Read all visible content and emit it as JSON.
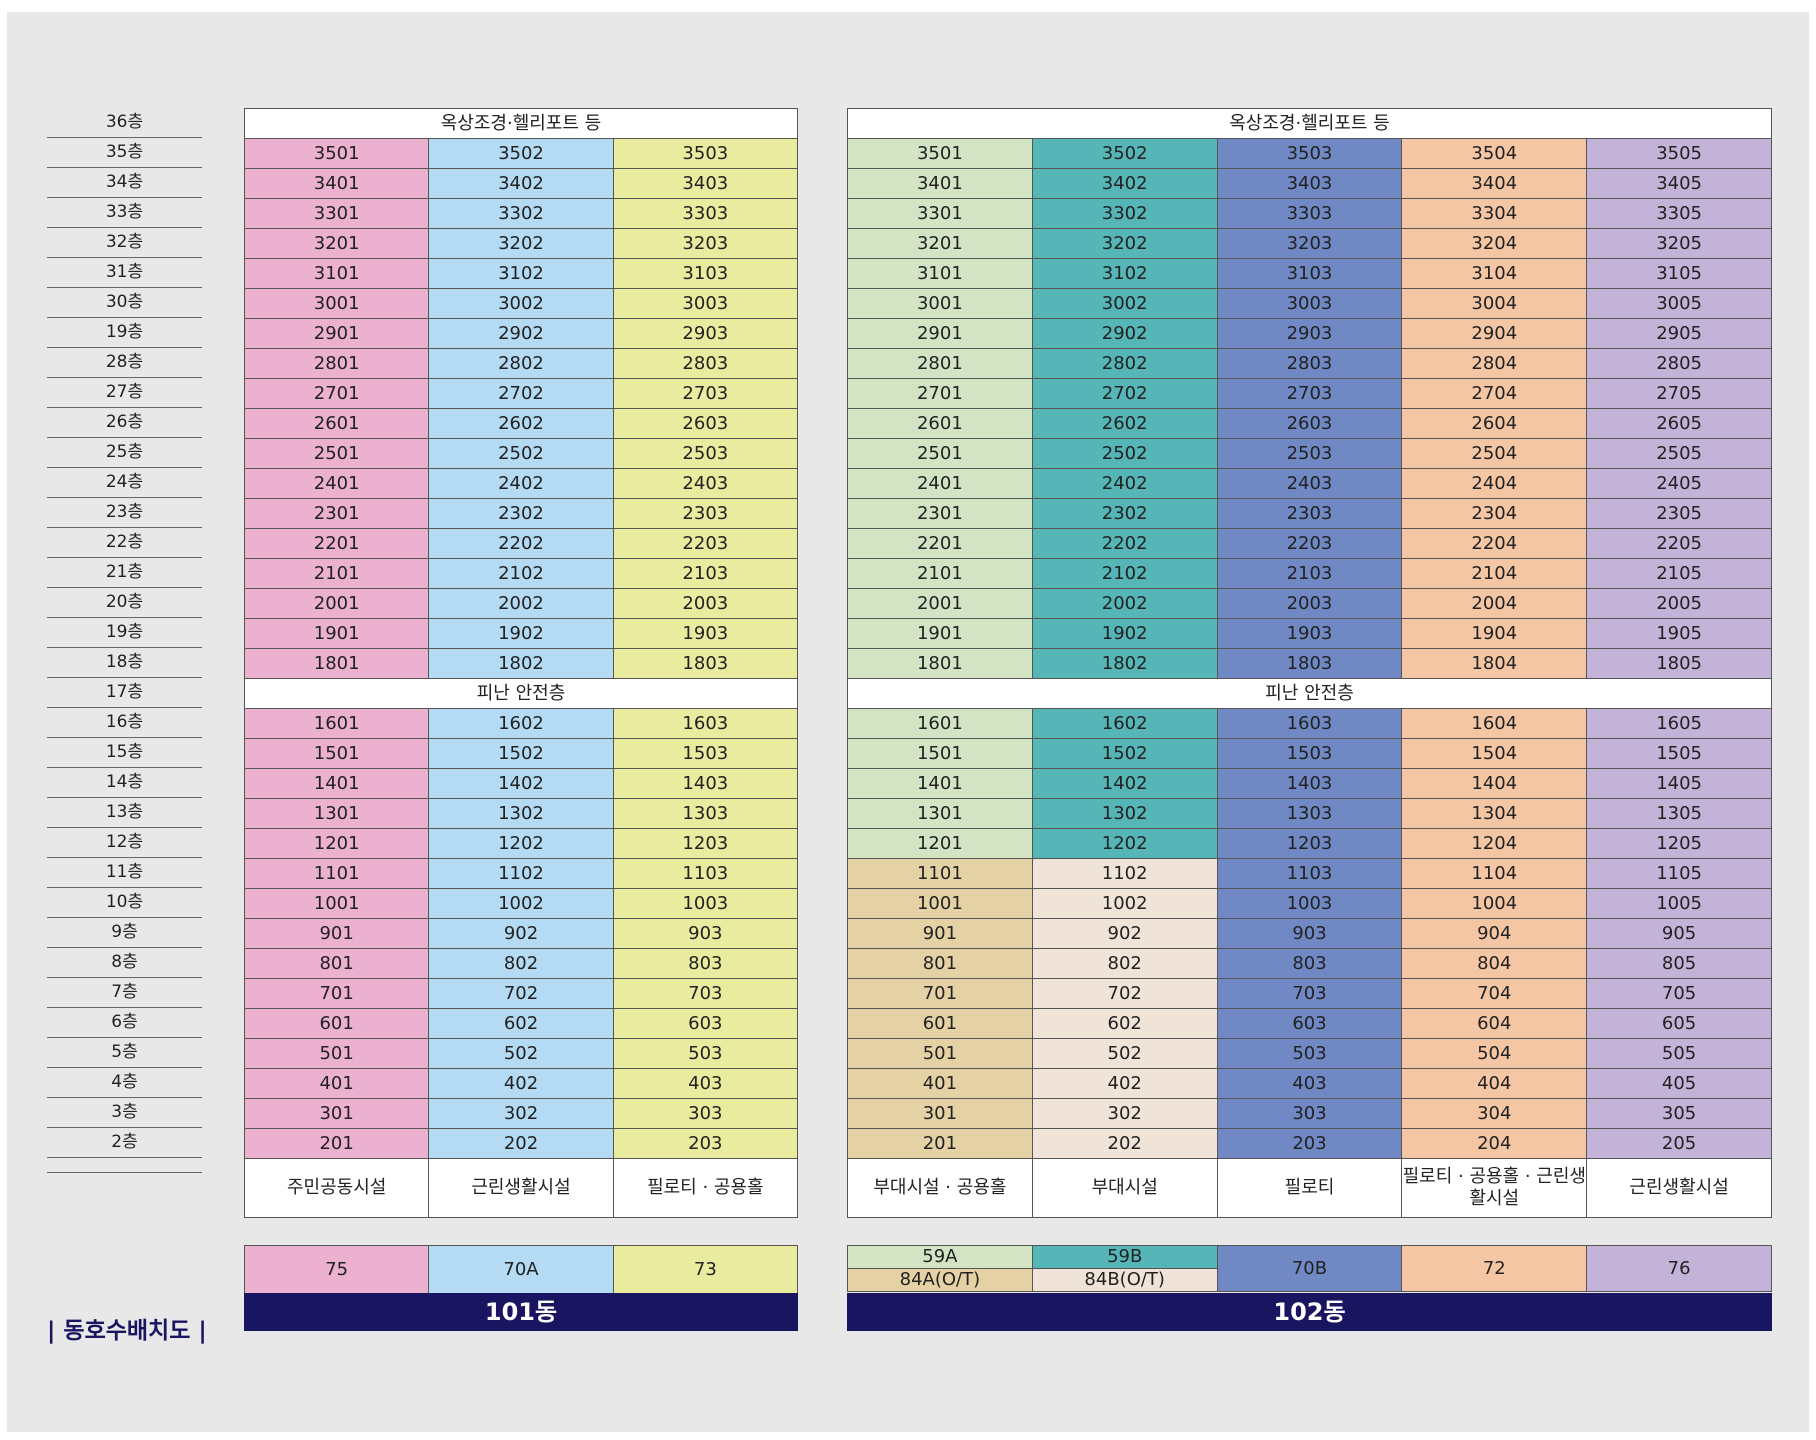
{
  "doc_title": "| 동호수배치도 |",
  "floors": [
    "36층",
    "35층",
    "34층",
    "33층",
    "32층",
    "31층",
    "30층",
    "19층",
    "28층",
    "27층",
    "26층",
    "25층",
    "24층",
    "23층",
    "22층",
    "21층",
    "20층",
    "19층",
    "18층",
    "17층",
    "16층",
    "15층",
    "14층",
    "13층",
    "12층",
    "11층",
    "10층",
    "9층",
    "8층",
    "7층",
    "6층",
    "5층",
    "4층",
    "3층",
    "2층"
  ],
  "colors": {
    "pink": "#ebb1cf",
    "lightblue": "#b4dbf3",
    "yellow": "#e9ec9f",
    "palegreen": "#d3e4c5",
    "teal": "#56b5b6",
    "blue": "#7089c4",
    "orange": "#f4c6a4",
    "purple": "#c4b3d9",
    "tan": "#e4d1a4",
    "beige": "#f0e4d8",
    "navy": "#1a1560"
  },
  "buildings": [
    {
      "name": "101동",
      "roof_label": "옥상조경·헬리포트 등",
      "refuge_label": "피난 안전층",
      "unit_colors": [
        [
          "pink",
          "lightblue",
          "yellow"
        ],
        [
          "pink",
          "lightblue",
          "yellow"
        ],
        [
          "pink",
          "lightblue",
          "yellow"
        ],
        [
          "pink",
          "lightblue",
          "yellow"
        ],
        [
          "pink",
          "lightblue",
          "yellow"
        ],
        [
          "pink",
          "lightblue",
          "yellow"
        ],
        [
          "pink",
          "lightblue",
          "yellow"
        ],
        [
          "pink",
          "lightblue",
          "yellow"
        ],
        [
          "pink",
          "lightblue",
          "yellow"
        ],
        [
          "pink",
          "lightblue",
          "yellow"
        ],
        [
          "pink",
          "lightblue",
          "yellow"
        ],
        [
          "pink",
          "lightblue",
          "yellow"
        ],
        [
          "pink",
          "lightblue",
          "yellow"
        ],
        [
          "pink",
          "lightblue",
          "yellow"
        ],
        [
          "pink",
          "lightblue",
          "yellow"
        ],
        [
          "pink",
          "lightblue",
          "yellow"
        ],
        [
          "pink",
          "lightblue",
          "yellow"
        ],
        [
          "pink",
          "lightblue",
          "yellow"
        ],
        [
          "pink",
          "lightblue",
          "yellow"
        ],
        [
          "pink",
          "lightblue",
          "yellow"
        ],
        [
          "pink",
          "lightblue",
          "yellow"
        ],
        [
          "pink",
          "lightblue",
          "yellow"
        ],
        [
          "pink",
          "lightblue",
          "yellow"
        ],
        [
          "pink",
          "lightblue",
          "yellow"
        ],
        [
          "pink",
          "lightblue",
          "yellow"
        ],
        [
          "pink",
          "lightblue",
          "yellow"
        ],
        [
          "pink",
          "lightblue",
          "yellow"
        ],
        [
          "pink",
          "lightblue",
          "yellow"
        ],
        [
          "pink",
          "lightblue",
          "yellow"
        ],
        [
          "pink",
          "lightblue",
          "yellow"
        ],
        [
          "pink",
          "lightblue",
          "yellow"
        ],
        [
          "pink",
          "lightblue",
          "yellow"
        ],
        [
          "pink",
          "lightblue",
          "yellow"
        ]
      ],
      "upper_units": [
        [
          "3501",
          "3502",
          "3503"
        ],
        [
          "3401",
          "3402",
          "3403"
        ],
        [
          "3301",
          "3302",
          "3303"
        ],
        [
          "3201",
          "3202",
          "3203"
        ],
        [
          "3101",
          "3102",
          "3103"
        ],
        [
          "3001",
          "3002",
          "3003"
        ],
        [
          "2901",
          "2902",
          "2903"
        ],
        [
          "2801",
          "2802",
          "2803"
        ],
        [
          "2701",
          "2702",
          "2703"
        ],
        [
          "2601",
          "2602",
          "2603"
        ],
        [
          "2501",
          "2502",
          "2503"
        ],
        [
          "2401",
          "2402",
          "2403"
        ],
        [
          "2301",
          "2302",
          "2303"
        ],
        [
          "2201",
          "2202",
          "2203"
        ],
        [
          "2101",
          "2102",
          "2103"
        ],
        [
          "2001",
          "2002",
          "2003"
        ],
        [
          "1901",
          "1902",
          "1903"
        ],
        [
          "1801",
          "1802",
          "1803"
        ]
      ],
      "lower_units": [
        [
          "1601",
          "1602",
          "1603"
        ],
        [
          "1501",
          "1502",
          "1503"
        ],
        [
          "1401",
          "1402",
          "1403"
        ],
        [
          "1301",
          "1302",
          "1303"
        ],
        [
          "1201",
          "1202",
          "1203"
        ],
        [
          "1101",
          "1102",
          "1103"
        ],
        [
          "1001",
          "1002",
          "1003"
        ],
        [
          "901",
          "902",
          "903"
        ],
        [
          "801",
          "802",
          "803"
        ],
        [
          "701",
          "702",
          "703"
        ],
        [
          "601",
          "602",
          "603"
        ],
        [
          "501",
          "502",
          "503"
        ],
        [
          "401",
          "402",
          "403"
        ],
        [
          "301",
          "302",
          "303"
        ],
        [
          "201",
          "202",
          "203"
        ]
      ],
      "ground_usage": [
        "주민공동시설",
        "근린생활시설",
        "필로티 · 공용홀"
      ],
      "legend": [
        {
          "label": "75",
          "color": "pink"
        },
        {
          "label": "70A",
          "color": "lightblue"
        },
        {
          "label": "73",
          "color": "yellow"
        }
      ]
    },
    {
      "name": "102동",
      "roof_label": "옥상조경·헬리포트 등",
      "refuge_label": "피난 안전층",
      "upper_colors": [
        "palegreen",
        "teal",
        "blue",
        "orange",
        "purple"
      ],
      "lower_colors_high": [
        "palegreen",
        "teal",
        "blue",
        "orange",
        "purple"
      ],
      "lower_colors_low": [
        "tan",
        "beige",
        "blue",
        "orange",
        "purple"
      ],
      "high_lower_rows": 5,
      "upper_units": [
        [
          "3501",
          "3502",
          "3503",
          "3504",
          "3505"
        ],
        [
          "3401",
          "3402",
          "3403",
          "3404",
          "3405"
        ],
        [
          "3301",
          "3302",
          "3303",
          "3304",
          "3305"
        ],
        [
          "3201",
          "3202",
          "3203",
          "3204",
          "3205"
        ],
        [
          "3101",
          "3102",
          "3103",
          "3104",
          "3105"
        ],
        [
          "3001",
          "3002",
          "3003",
          "3004",
          "3005"
        ],
        [
          "2901",
          "2902",
          "2903",
          "2904",
          "2905"
        ],
        [
          "2801",
          "2802",
          "2803",
          "2804",
          "2805"
        ],
        [
          "2701",
          "2702",
          "2703",
          "2704",
          "2705"
        ],
        [
          "2601",
          "2602",
          "2603",
          "2604",
          "2605"
        ],
        [
          "2501",
          "2502",
          "2503",
          "2504",
          "2505"
        ],
        [
          "2401",
          "2402",
          "2403",
          "2404",
          "2405"
        ],
        [
          "2301",
          "2302",
          "2303",
          "2304",
          "2305"
        ],
        [
          "2201",
          "2202",
          "2203",
          "2204",
          "2205"
        ],
        [
          "2101",
          "2102",
          "2103",
          "2104",
          "2105"
        ],
        [
          "2001",
          "2002",
          "2003",
          "2004",
          "2005"
        ],
        [
          "1901",
          "1902",
          "1903",
          "1904",
          "1905"
        ],
        [
          "1801",
          "1802",
          "1803",
          "1804",
          "1805"
        ]
      ],
      "lower_units": [
        [
          "1601",
          "1602",
          "1603",
          "1604",
          "1605"
        ],
        [
          "1501",
          "1502",
          "1503",
          "1504",
          "1505"
        ],
        [
          "1401",
          "1402",
          "1403",
          "1404",
          "1405"
        ],
        [
          "1301",
          "1302",
          "1303",
          "1304",
          "1305"
        ],
        [
          "1201",
          "1202",
          "1203",
          "1204",
          "1205"
        ],
        [
          "1101",
          "1102",
          "1103",
          "1104",
          "1105"
        ],
        [
          "1001",
          "1002",
          "1003",
          "1004",
          "1005"
        ],
        [
          "901",
          "902",
          "903",
          "904",
          "905"
        ],
        [
          "801",
          "802",
          "803",
          "804",
          "805"
        ],
        [
          "701",
          "702",
          "703",
          "704",
          "705"
        ],
        [
          "601",
          "602",
          "603",
          "604",
          "605"
        ],
        [
          "501",
          "502",
          "503",
          "504",
          "505"
        ],
        [
          "401",
          "402",
          "403",
          "404",
          "405"
        ],
        [
          "301",
          "302",
          "303",
          "304",
          "305"
        ],
        [
          "201",
          "202",
          "203",
          "204",
          "205"
        ]
      ],
      "ground_usage": [
        "부대시설 · 공용홀",
        "부대시설",
        "필로티",
        "필로티 · 공용홀 · 근린생활시설",
        "근린생활시설"
      ],
      "legend": {
        "split": [
          {
            "top": "59A",
            "top_color": "palegreen",
            "bottom": "84A(O/T)",
            "bottom_color": "tan"
          },
          {
            "top": "59B",
            "top_color": "teal",
            "bottom": "84B(O/T)",
            "bottom_color": "beige"
          }
        ],
        "full": [
          {
            "label": "70B",
            "color": "blue"
          },
          {
            "label": "72",
            "color": "orange"
          },
          {
            "label": "76",
            "color": "purple"
          }
        ]
      }
    }
  ]
}
